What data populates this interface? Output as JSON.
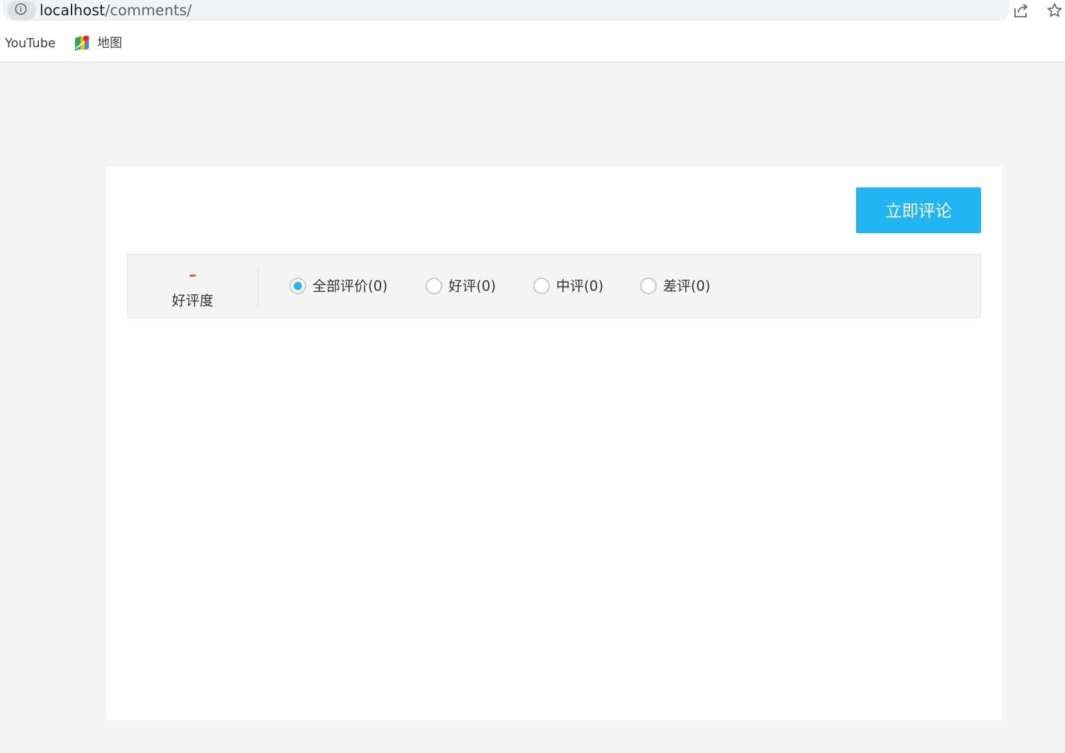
{
  "browser": {
    "url_host": "localhost",
    "url_path": "/comments/",
    "bookmarks": [
      {
        "label": "YouTube"
      },
      {
        "label": "地图"
      }
    ]
  },
  "comments": {
    "submit_button_label": "立即评论",
    "rating": {
      "value": "–",
      "label": "好评度"
    },
    "filters": [
      {
        "label": "全部评价(0)",
        "checked": true
      },
      {
        "label": "好评(0)",
        "checked": false
      },
      {
        "label": "中评(0)",
        "checked": false
      },
      {
        "label": "差评(0)",
        "checked": false
      }
    ]
  },
  "colors": {
    "accent": "#22b5f3",
    "rating": "#e4501f",
    "page_bg": "#f4f4f4"
  }
}
